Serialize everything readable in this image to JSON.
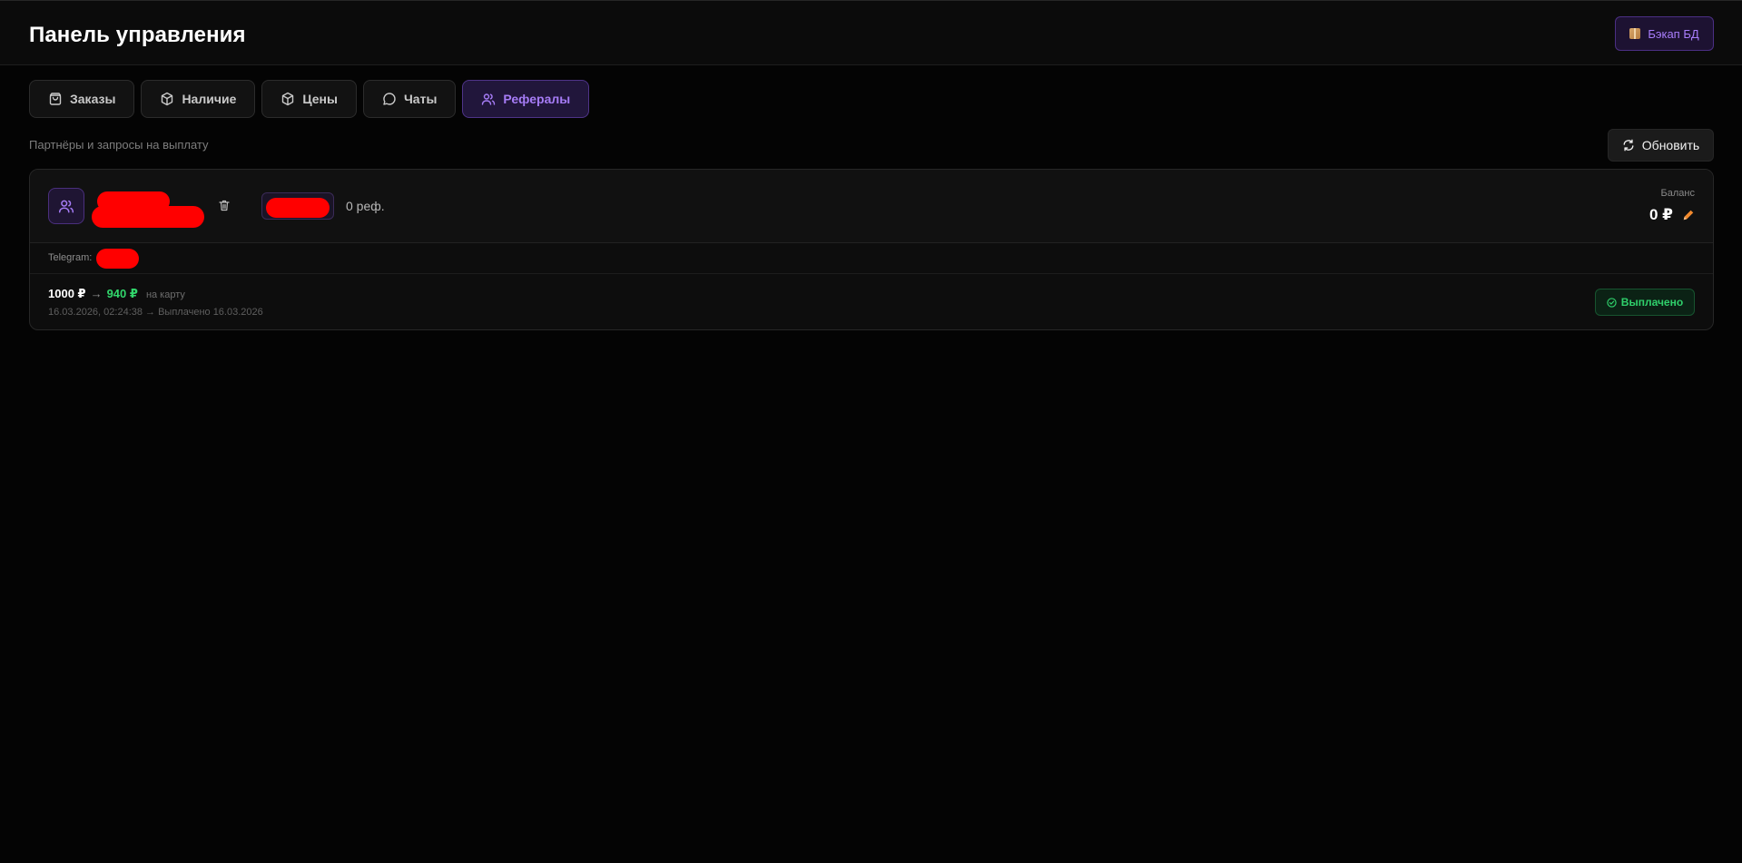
{
  "header": {
    "title": "Панель управления",
    "backup_label": "Бэкап БД"
  },
  "tabs": [
    {
      "label": "Заказы",
      "icon": "bag-icon",
      "active": false
    },
    {
      "label": "Наличие",
      "icon": "box-icon",
      "active": false
    },
    {
      "label": "Цены",
      "icon": "box-icon",
      "active": false
    },
    {
      "label": "Чаты",
      "icon": "chat-icon",
      "active": false
    },
    {
      "label": "Рефералы",
      "icon": "users-icon",
      "active": true
    }
  ],
  "section": {
    "subtitle": "Партнёры и запросы на выплату",
    "refresh_label": "Обновить"
  },
  "partner": {
    "ref_count": "0 реф.",
    "balance_label": "Баланс",
    "balance_value": "0 ₽",
    "telegram_label": "Telegram:"
  },
  "payout": {
    "amount": "1000 ₽",
    "arrow": "→",
    "net_amount": "940 ₽",
    "method": "на карту",
    "meta": "16.03.2026, 02:24:38 → Выплачено 16.03.2026",
    "status": "Выплачено"
  },
  "colors": {
    "accent": "#a67cf6",
    "success": "#2fd06b",
    "background": "#040404",
    "redaction": "#ff0000"
  }
}
